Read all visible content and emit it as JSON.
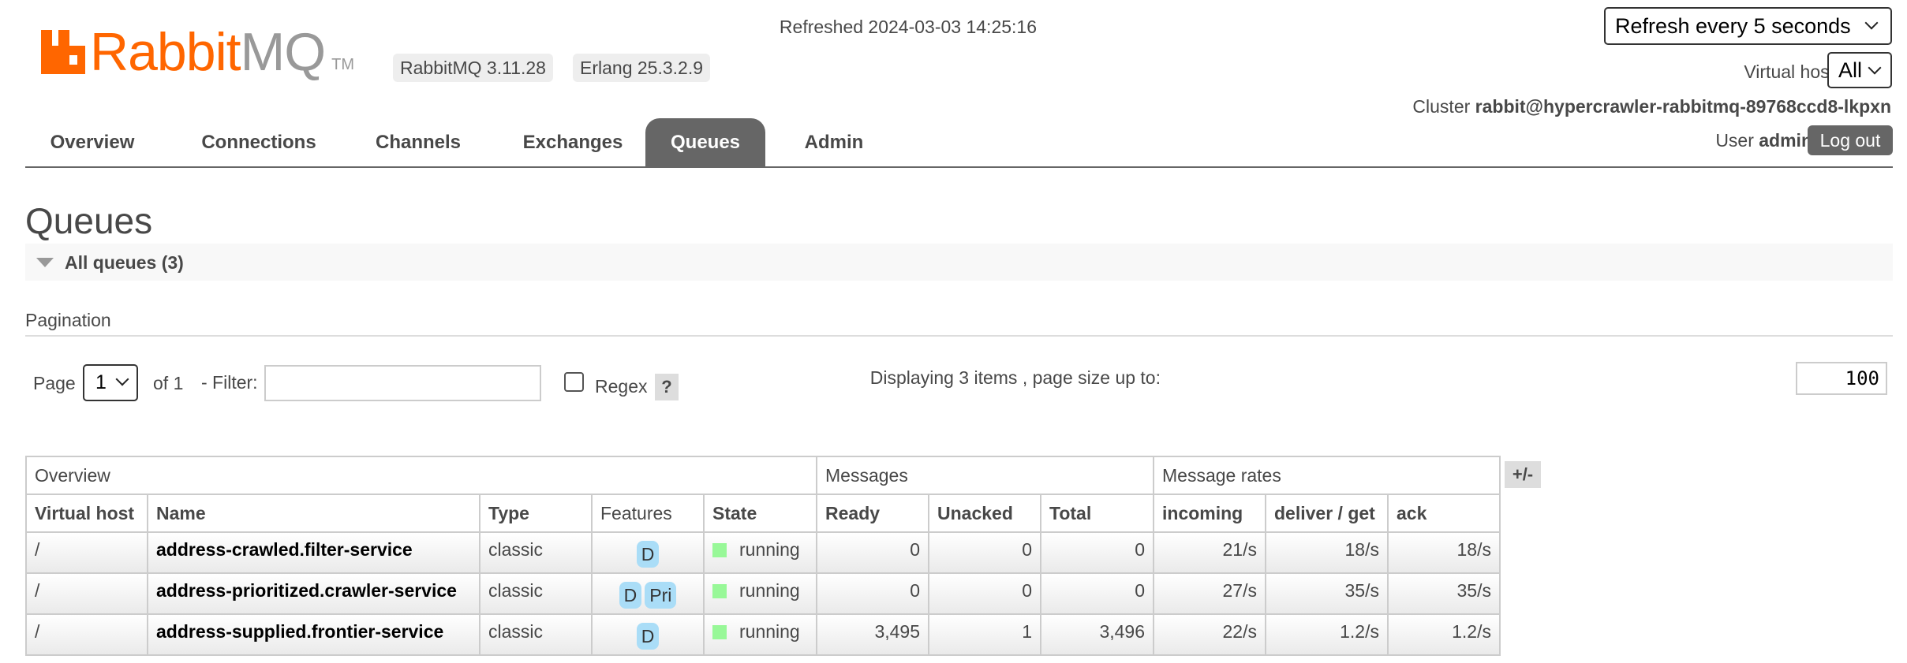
{
  "logo": {
    "rabbit": "Rabbit",
    "mq": "MQ",
    "tm": "TM"
  },
  "versions": {
    "rabbitmq": "RabbitMQ 3.11.28",
    "erlang": "Erlang 25.3.2.9"
  },
  "header": {
    "refreshed": "Refreshed 2024-03-03 14:25:16",
    "refresh_option": "Refresh every 5 seconds",
    "vhost_label": "Virtual host",
    "vhost_value": "All",
    "cluster_label": "Cluster",
    "cluster_name": "rabbit@hypercrawler-rabbitmq-89768ccd8-lkpxn",
    "user_label": "User",
    "user_name": "admin",
    "logout": "Log out"
  },
  "tabs": [
    {
      "label": "Overview"
    },
    {
      "label": "Connections"
    },
    {
      "label": "Channels"
    },
    {
      "label": "Exchanges"
    },
    {
      "label": "Queues",
      "active": true
    },
    {
      "label": "Admin"
    }
  ],
  "page": {
    "title": "Queues",
    "section": "All queues (3)",
    "pagination_heading": "Pagination",
    "page_label": "Page",
    "page_value": "1",
    "of_label": "of 1",
    "filter_label": "- Filter:",
    "filter_value": "",
    "regex_label": "Regex",
    "regex_help": "?",
    "displaying": "Displaying 3 items , page size up to:",
    "page_size": "100",
    "columns_toggle": "+/-"
  },
  "table": {
    "groups": [
      "Overview",
      "Messages",
      "Message rates"
    ],
    "headers": [
      "Virtual host",
      "Name",
      "Type",
      "Features",
      "State",
      "Ready",
      "Unacked",
      "Total",
      "incoming",
      "deliver / get",
      "ack"
    ],
    "rows": [
      {
        "vhost": "/",
        "name": "address-crawled.filter-service",
        "type": "classic",
        "features": [
          "D"
        ],
        "state": "running",
        "ready": "0",
        "unacked": "0",
        "total": "0",
        "incoming": "21/s",
        "deliver": "18/s",
        "ack": "18/s"
      },
      {
        "vhost": "/",
        "name": "address-prioritized.crawler-service",
        "type": "classic",
        "features": [
          "D",
          "Pri"
        ],
        "state": "running",
        "ready": "0",
        "unacked": "0",
        "total": "0",
        "incoming": "27/s",
        "deliver": "35/s",
        "ack": "35/s"
      },
      {
        "vhost": "/",
        "name": "address-supplied.frontier-service",
        "type": "classic",
        "features": [
          "D"
        ],
        "state": "running",
        "ready": "3,495",
        "unacked": "1",
        "total": "3,496",
        "incoming": "22/s",
        "deliver": "1.2/s",
        "ack": "1.2/s"
      }
    ]
  },
  "colors": {
    "brand": "#ff6600",
    "tab_active": "#666666",
    "state_running": "#98f898",
    "feature_badge": "#aaddf7"
  }
}
